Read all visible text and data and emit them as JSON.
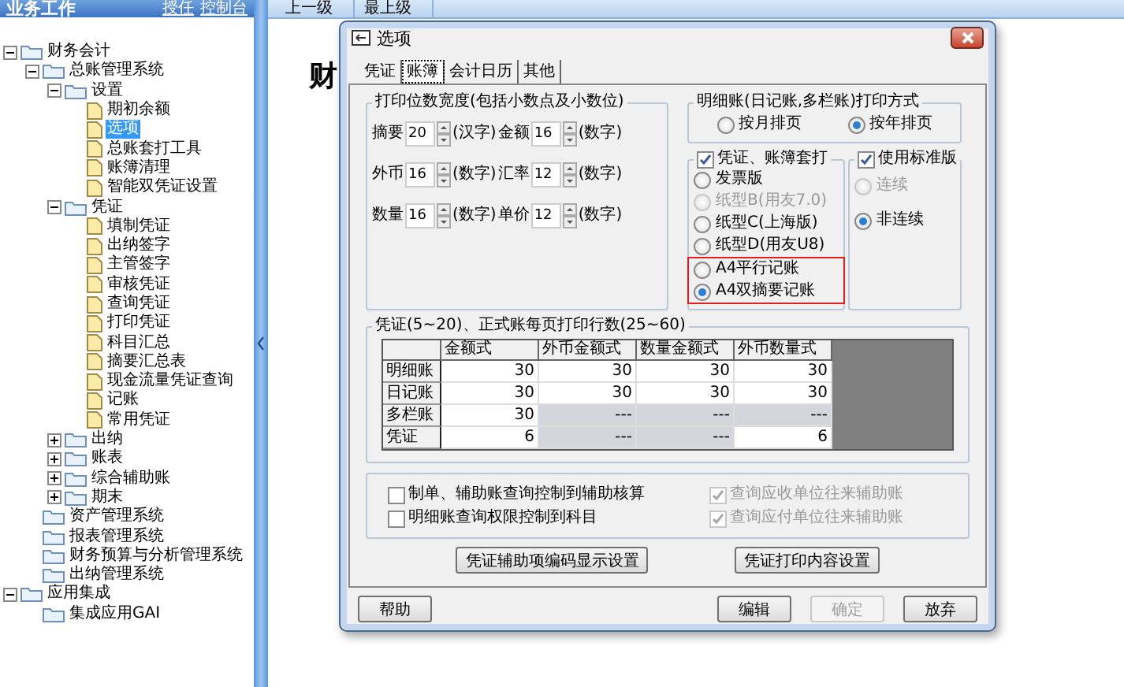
{
  "sidebar": {
    "title": "业务工作",
    "links": [
      "授任",
      "控制台"
    ],
    "tree": [
      {
        "label": "财务会计",
        "kind": "branch",
        "expanded": true,
        "selected": false,
        "children": [
          {
            "label": "总账管理系统",
            "kind": "branch",
            "expanded": true,
            "selected": false,
            "children": [
              {
                "label": "设置",
                "kind": "branch",
                "expanded": true,
                "selected": false,
                "children": [
                  {
                    "label": "期初余额",
                    "kind": "page",
                    "selected": false
                  },
                  {
                    "label": "选项",
                    "kind": "page",
                    "selected": true
                  },
                  {
                    "label": "总账套打工具",
                    "kind": "page",
                    "selected": false
                  },
                  {
                    "label": "账簿清理",
                    "kind": "page",
                    "selected": false
                  },
                  {
                    "label": "智能双凭证设置",
                    "kind": "page",
                    "selected": false
                  }
                ]
              },
              {
                "label": "凭证",
                "kind": "branch",
                "expanded": true,
                "selected": false,
                "children": [
                  {
                    "label": "填制凭证",
                    "kind": "page",
                    "selected": false
                  },
                  {
                    "label": "出纳签字",
                    "kind": "page",
                    "selected": false
                  },
                  {
                    "label": "主管签字",
                    "kind": "page",
                    "selected": false
                  },
                  {
                    "label": "审核凭证",
                    "kind": "page",
                    "selected": false
                  },
                  {
                    "label": "查询凭证",
                    "kind": "page",
                    "selected": false
                  },
                  {
                    "label": "打印凭证",
                    "kind": "page",
                    "selected": false
                  },
                  {
                    "label": "科目汇总",
                    "kind": "page",
                    "selected": false
                  },
                  {
                    "label": "摘要汇总表",
                    "kind": "page",
                    "selected": false
                  },
                  {
                    "label": "现金流量凭证查询",
                    "kind": "page",
                    "selected": false
                  },
                  {
                    "label": "记账",
                    "kind": "page",
                    "selected": false
                  },
                  {
                    "label": "常用凭证",
                    "kind": "page",
                    "selected": false
                  }
                ]
              },
              {
                "label": "出纳",
                "kind": "branch",
                "expanded": false,
                "selected": false
              },
              {
                "label": "账表",
                "kind": "branch",
                "expanded": false,
                "selected": false
              },
              {
                "label": "综合辅助账",
                "kind": "branch",
                "expanded": false,
                "selected": false
              },
              {
                "label": "期末",
                "kind": "branch",
                "expanded": false,
                "selected": false
              }
            ]
          },
          {
            "label": "资产管理系统",
            "kind": "folder",
            "selected": false
          },
          {
            "label": "报表管理系统",
            "kind": "folder",
            "selected": false
          },
          {
            "label": "财务预算与分析管理系统",
            "kind": "folder",
            "selected": false
          },
          {
            "label": "出纳管理系统",
            "kind": "folder",
            "selected": false
          }
        ]
      },
      {
        "label": "应用集成",
        "kind": "branch",
        "expanded": true,
        "selected": false,
        "children": [
          {
            "label": "集成应用GAI",
            "kind": "folder",
            "selected": false
          }
        ]
      }
    ]
  },
  "toolbar": {
    "buttons": [
      "上一级",
      "最上级"
    ]
  },
  "main": {
    "heading": "财"
  },
  "dialog": {
    "title": "选项",
    "tabs": [
      {
        "label": "凭证",
        "selected": false
      },
      {
        "label": "账簿",
        "selected": true
      },
      {
        "label": "会计日历",
        "selected": false
      },
      {
        "label": "其他",
        "selected": false
      }
    ],
    "print_width": {
      "title": "打印位数宽度(包括小数点及小数位)",
      "rows": [
        [
          {
            "label": "摘要",
            "value": "20",
            "unit": "(汉字)"
          },
          {
            "label": "金额",
            "value": "16",
            "unit": "(数字)"
          }
        ],
        [
          {
            "label": "外币",
            "value": "16",
            "unit": "(数字)"
          },
          {
            "label": "汇率",
            "value": "12",
            "unit": "(数字)"
          }
        ],
        [
          {
            "label": "数量",
            "value": "16",
            "unit": "(数字)"
          },
          {
            "label": "单价",
            "value": "12",
            "unit": "(数字)"
          }
        ]
      ]
    },
    "detail_print": {
      "title": "明细账(日记账,多栏账)打印方式",
      "options": [
        {
          "label": "按月排页",
          "selected": false
        },
        {
          "label": "按年排页",
          "selected": true
        }
      ]
    },
    "overprint": {
      "label": "凭证、账簿套打",
      "checked": true,
      "options": [
        {
          "label": "发票版",
          "selected": false,
          "disabled": false,
          "highlighted": false
        },
        {
          "label": "纸型B(用友7.0)",
          "selected": false,
          "disabled": true,
          "highlighted": false
        },
        {
          "label": "纸型C(上海版)",
          "selected": false,
          "disabled": false,
          "highlighted": false
        },
        {
          "label": "纸型D(用友U8)",
          "selected": false,
          "disabled": false,
          "highlighted": false
        },
        {
          "label": "A4平行记账",
          "selected": false,
          "disabled": false,
          "highlighted": true
        },
        {
          "label": "A4双摘要记账",
          "selected": true,
          "disabled": false,
          "highlighted": true
        }
      ]
    },
    "standard": {
      "label": "使用标准版",
      "checked": true,
      "options": [
        {
          "label": "连续",
          "selected": false,
          "disabled": true
        },
        {
          "label": "非连续",
          "selected": true,
          "disabled": false
        }
      ]
    },
    "lines": {
      "title": "凭证(5~20)、正式账每页打印行数(25~60)",
      "columns": [
        "金额式",
        "外币金额式",
        "数量金额式",
        "外币数量式"
      ],
      "rows": [
        {
          "label": "明细账",
          "cells": [
            {
              "value": "30",
              "disabled": false
            },
            {
              "value": "30",
              "disabled": false
            },
            {
              "value": "30",
              "disabled": false
            },
            {
              "value": "30",
              "disabled": false
            }
          ]
        },
        {
          "label": "日记账",
          "cells": [
            {
              "value": "30",
              "disabled": false
            },
            {
              "value": "30",
              "disabled": false
            },
            {
              "value": "30",
              "disabled": false
            },
            {
              "value": "30",
              "disabled": false
            }
          ]
        },
        {
          "label": "多栏账",
          "cells": [
            {
              "value": "30",
              "disabled": false
            },
            {
              "value": "---",
              "disabled": true
            },
            {
              "value": "---",
              "disabled": true
            },
            {
              "value": "---",
              "disabled": true
            }
          ]
        },
        {
          "label": "凭证",
          "cells": [
            {
              "value": "6",
              "disabled": false
            },
            {
              "value": "---",
              "disabled": true
            },
            {
              "value": "---",
              "disabled": true
            },
            {
              "value": "6",
              "disabled": false
            }
          ]
        }
      ]
    },
    "checks": [
      {
        "label": "制单、辅助账查询控制到辅助核算",
        "checked": false,
        "disabled": false
      },
      {
        "label": "查询应收单位往来辅助账",
        "checked": true,
        "disabled": true
      },
      {
        "label": "明细账查询权限控制到科目",
        "checked": false,
        "disabled": false
      },
      {
        "label": "查询应付单位往来辅助账",
        "checked": true,
        "disabled": true
      }
    ],
    "action_buttons": [
      "凭证辅助项编码显示设置",
      "凭证打印内容设置"
    ],
    "footer_buttons": [
      {
        "label": "帮助",
        "disabled": false
      },
      {
        "label": "编辑",
        "disabled": false
      },
      {
        "label": "确定",
        "disabled": true
      },
      {
        "label": "放弃",
        "disabled": false
      }
    ]
  }
}
